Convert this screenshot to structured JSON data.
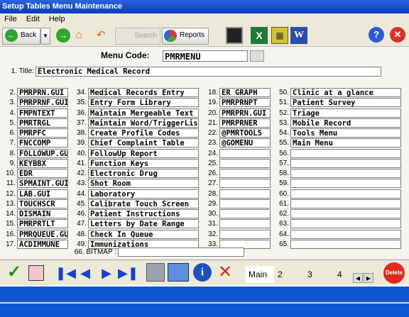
{
  "window": {
    "title": "Setup Tables  Menu Maintenance"
  },
  "menu": [
    "File",
    "Edit",
    "Help"
  ],
  "toolbar": {
    "back_label": "Back",
    "search_placeholder": "Search",
    "reports_label": "Reports"
  },
  "header": {
    "menu_code_label": "Menu Code:",
    "menu_code_value": "PMRMENU"
  },
  "title_row": {
    "label": "1. Title:",
    "value": "Electronic Medical Record"
  },
  "columns": [
    {
      "items": [
        {
          "num": "2.",
          "value": "PMRPRN.GUI"
        },
        {
          "num": "3.",
          "value": "PMRPRNF.GUI"
        },
        {
          "num": "4.",
          "value": "FMPNTEXT"
        },
        {
          "num": "5.",
          "value": "PMRTRGL"
        },
        {
          "num": "6.",
          "value": "PMRPFC"
        },
        {
          "num": "7.",
          "value": "FNCCOMP"
        },
        {
          "num": "8.",
          "value": "FOLLOWUP.GUI"
        },
        {
          "num": "9.",
          "value": "KEYBBX"
        },
        {
          "num": "10.",
          "value": "EDR"
        },
        {
          "num": "11.",
          "value": "SPMAINT.GUI"
        },
        {
          "num": "12.",
          "value": "LAB.GUI"
        },
        {
          "num": "13.",
          "value": "TOUCHSCR"
        },
        {
          "num": "14.",
          "value": "DISMAIN"
        },
        {
          "num": "15.",
          "value": "PMRPRTLT"
        },
        {
          "num": "16.",
          "value": "PMRQUEUE.GUI"
        },
        {
          "num": "17.",
          "value": "ACDIMMUNE"
        }
      ]
    },
    {
      "items": [
        {
          "num": "34.",
          "value": "Medical Records Entry"
        },
        {
          "num": "35.",
          "value": "Entry Form Library"
        },
        {
          "num": "36.",
          "value": "Maintain Mergeable Text"
        },
        {
          "num": "37.",
          "value": "Maintain Word/TriggerList"
        },
        {
          "num": "38.",
          "value": "Create Profile Codes"
        },
        {
          "num": "39.",
          "value": "Chief Complaint Table"
        },
        {
          "num": "40.",
          "value": "FollowUp Report"
        },
        {
          "num": "41.",
          "value": "Function Keys"
        },
        {
          "num": "42.",
          "value": "Electronic Drug"
        },
        {
          "num": "43.",
          "value": "Shot Room"
        },
        {
          "num": "44.",
          "value": "Laboratory"
        },
        {
          "num": "45.",
          "value": "Calibrate Touch Screen"
        },
        {
          "num": "46.",
          "value": "Patient Instructions"
        },
        {
          "num": "47.",
          "value": "Letters by Date Range"
        },
        {
          "num": "48.",
          "value": "Check In Queue"
        },
        {
          "num": "49.",
          "value": "Immunizations"
        }
      ]
    },
    {
      "items": [
        {
          "num": "18.",
          "value": "ER GRAPH"
        },
        {
          "num": "19.",
          "value": "PMRPRNPT"
        },
        {
          "num": "20.",
          "value": "PMRPRN.GUI"
        },
        {
          "num": "21.",
          "value": "PMRPRNER"
        },
        {
          "num": "22.",
          "value": "@PMRTOOLS"
        },
        {
          "num": "23.",
          "value": "@GOMENU"
        },
        {
          "num": "24.",
          "value": ""
        },
        {
          "num": "25.",
          "value": ""
        },
        {
          "num": "26.",
          "value": ""
        },
        {
          "num": "27.",
          "value": ""
        },
        {
          "num": "28.",
          "value": ""
        },
        {
          "num": "29.",
          "value": ""
        },
        {
          "num": "30.",
          "value": ""
        },
        {
          "num": "31.",
          "value": ""
        },
        {
          "num": "32.",
          "value": ""
        },
        {
          "num": "33.",
          "value": ""
        }
      ]
    },
    {
      "items": [
        {
          "num": "50.",
          "value": "Clinic at a glance"
        },
        {
          "num": "51.",
          "value": "Patient Survey"
        },
        {
          "num": "52.",
          "value": "Triage"
        },
        {
          "num": "53.",
          "value": "Mobile Record"
        },
        {
          "num": "54.",
          "value": "Tools Menu"
        },
        {
          "num": "55.",
          "value": "Main Menu"
        },
        {
          "num": "56.",
          "value": ""
        },
        {
          "num": "57.",
          "value": ""
        },
        {
          "num": "58.",
          "value": ""
        },
        {
          "num": "59.",
          "value": ""
        },
        {
          "num": "60.",
          "value": ""
        },
        {
          "num": "61.",
          "value": ""
        },
        {
          "num": "62.",
          "value": ""
        },
        {
          "num": "63.",
          "value": ""
        },
        {
          "num": "64.",
          "value": ""
        },
        {
          "num": "65.",
          "value": ""
        }
      ]
    }
  ],
  "bitmap": {
    "label": "66. BITMAP :",
    "value": ""
  },
  "tabs": [
    "Main",
    "2",
    "3",
    "4"
  ],
  "delete_label": "Delete"
}
